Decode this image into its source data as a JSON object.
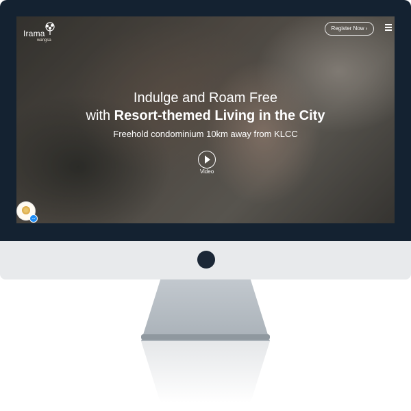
{
  "site": {
    "logo_main": "Irama",
    "logo_sub": "wangsa"
  },
  "header": {
    "register_label": "Register Now ›",
    "menu_icon": "hamburger-icon"
  },
  "hero": {
    "line1": "Indulge and Roam Free",
    "line2_prefix": "with ",
    "line2_bold": "Resort-themed Living in the City",
    "subtitle": "Freehold condominium 10km away from KLCC",
    "video_label": "Video",
    "play_icon": "play-icon"
  },
  "chat": {
    "avatar_icon": "chat-avatar",
    "badge_icon": "messenger-icon",
    "badge_color": "#1e8cf4"
  },
  "colors": {
    "bezel": "#142231",
    "chin": "#e8eaec"
  }
}
